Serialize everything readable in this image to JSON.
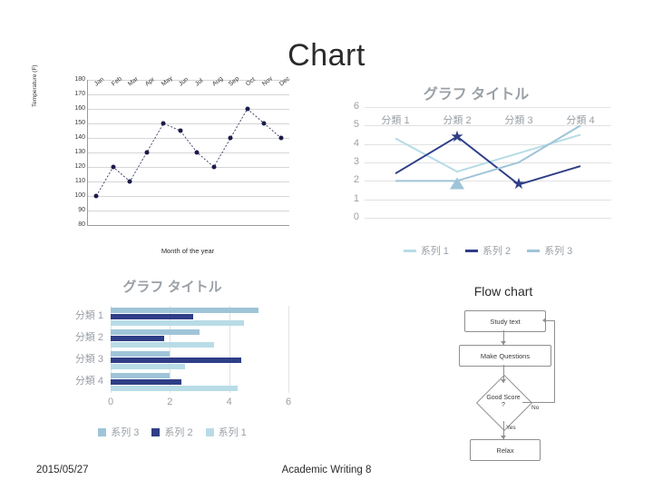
{
  "slide": {
    "title": "Chart",
    "footer_date": "2015/05/27",
    "footer_center": "Academic Writing 8",
    "flow_label": "Flow chart"
  },
  "chart_data": [
    {
      "id": "scatter",
      "type": "scatter",
      "title": "",
      "xlabel": "Month of the year",
      "ylabel": "Temperature (F)",
      "categories": [
        "Jan",
        "Feb",
        "Mar",
        "Apr",
        "May",
        "Jun",
        "Jul",
        "Aug",
        "Sep",
        "Oct",
        "Nov",
        "Dec"
      ],
      "yticks": [
        80,
        90,
        100,
        110,
        120,
        130,
        140,
        150,
        160,
        170,
        180
      ],
      "ylim": [
        80,
        180
      ],
      "values": [
        100,
        120,
        110,
        130,
        150,
        145,
        130,
        120,
        140,
        160,
        150,
        140
      ],
      "grid": true,
      "legend": "none"
    },
    {
      "id": "line",
      "type": "line",
      "title": "グラフ タイトル",
      "categories": [
        "分類 1",
        "分類 2",
        "分類 3",
        "分類 4"
      ],
      "yticks": [
        0,
        1,
        2,
        3,
        4,
        5,
        6
      ],
      "ylim": [
        0,
        6
      ],
      "series": [
        {
          "name": "系列 1",
          "values": [
            4.3,
            2.5,
            3.5,
            4.5
          ],
          "color": "#b8dce6"
        },
        {
          "name": "系列 2",
          "values": [
            2.4,
            4.4,
            1.8,
            2.8
          ],
          "color": "#2f3e87"
        },
        {
          "name": "系列 3",
          "values": [
            2.0,
            2.0,
            3.0,
            5.0
          ],
          "color": "#9fc4d8"
        }
      ],
      "grid": true,
      "legend_position": "bottom"
    },
    {
      "id": "bar",
      "type": "bar",
      "title": "グラフ タイトル",
      "orientation": "horizontal",
      "categories": [
        "分類 1",
        "分類 2",
        "分類 3",
        "分類 4"
      ],
      "xticks": [
        0,
        2,
        4,
        6
      ],
      "xlim": [
        0,
        6
      ],
      "series": [
        {
          "name": "系列 1",
          "values": [
            4.3,
            2.5,
            3.5,
            4.5
          ],
          "color": "#b8dce6"
        },
        {
          "name": "系列 2",
          "values": [
            2.4,
            4.4,
            1.8,
            2.8
          ],
          "color": "#2f3e87"
        },
        {
          "name": "系列 3",
          "values": [
            2.0,
            2.0,
            3.0,
            5.0
          ],
          "color": "#9fc4d8"
        }
      ],
      "grid": true,
      "legend_position": "bottom",
      "legend_order": [
        "系列 3",
        "系列 2",
        "系列 1"
      ]
    }
  ],
  "flowchart": {
    "nodes": [
      {
        "id": "study",
        "label": "Study text"
      },
      {
        "id": "questions",
        "label": "Make Questions"
      },
      {
        "id": "decision",
        "label": "Good Score ?"
      },
      {
        "id": "relax",
        "label": "Relax"
      }
    ],
    "edge_labels": {
      "yes": "Yes",
      "no": "No"
    }
  },
  "colors": {
    "series1": "#b8dce6",
    "series2": "#2f3e87",
    "series3": "#9fc4d8",
    "axis": "#9a9a9a",
    "grid": "#e2e2e2",
    "label": "#9aa0a6",
    "text": "#2b2b2b"
  }
}
